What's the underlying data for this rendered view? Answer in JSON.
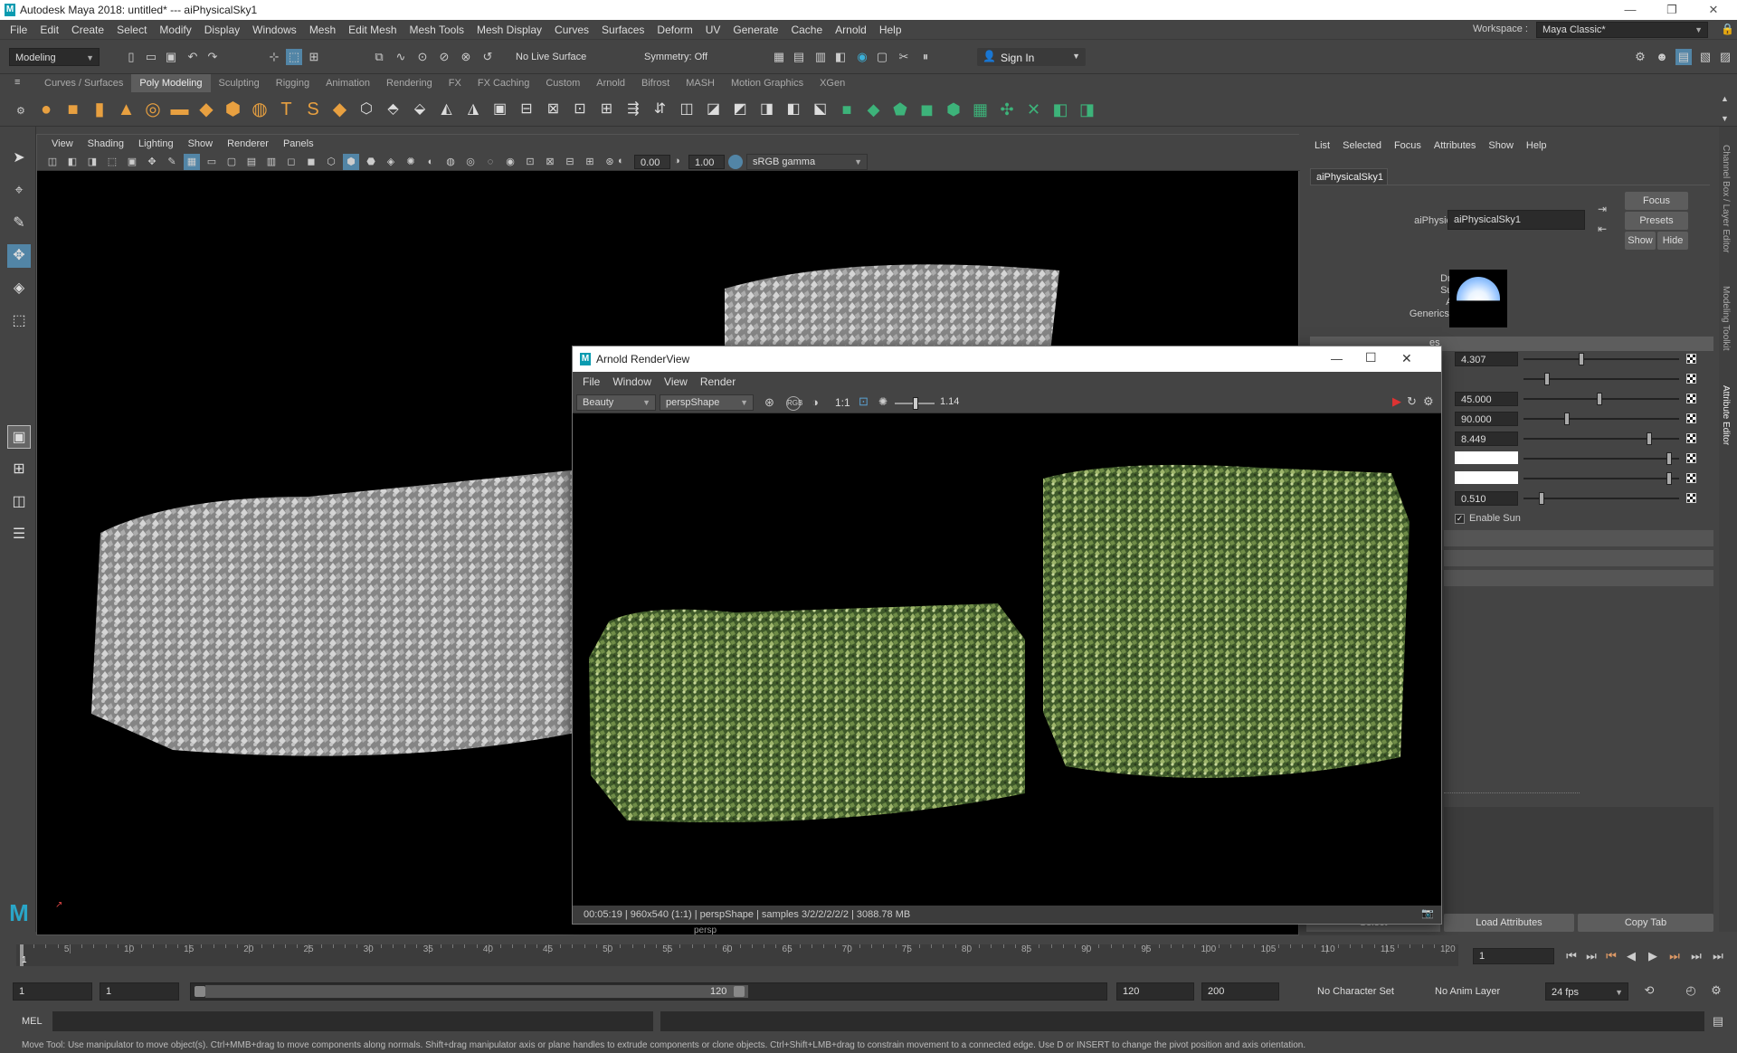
{
  "window": {
    "title": "Autodesk Maya 2018: untitled*   ---   aiPhysicalSky1"
  },
  "menubar": [
    "File",
    "Edit",
    "Create",
    "Select",
    "Modify",
    "Display",
    "Windows",
    "Mesh",
    "Edit Mesh",
    "Mesh Tools",
    "Mesh Display",
    "Curves",
    "Surfaces",
    "Deform",
    "UV",
    "Generate",
    "Cache",
    "Arnold",
    "Help"
  ],
  "status_line": {
    "menuset": "Modeling",
    "live_surface": "No Live Surface",
    "symmetry": "Symmetry: Off",
    "sign_in": "Sign In",
    "workspace_label": "Workspace :",
    "workspace_value": "Maya Classic*"
  },
  "shelf_tabs": [
    "Curves / Surfaces",
    "Poly Modeling",
    "Sculpting",
    "Rigging",
    "Animation",
    "Rendering",
    "FX",
    "FX Caching",
    "Custom",
    "Arnold",
    "Bifrost",
    "MASH",
    "Motion Graphics",
    "XGen"
  ],
  "shelf_active": "Poly Modeling",
  "viewport": {
    "menus": [
      "View",
      "Shading",
      "Lighting",
      "Show",
      "Renderer",
      "Panels"
    ],
    "exposure": "0.00",
    "gamma": "1.00",
    "color_space": "sRGB gamma",
    "camera_label": "persp"
  },
  "renderview": {
    "title": "Arnold RenderView",
    "menus": [
      "File",
      "Window",
      "View",
      "Render"
    ],
    "aov": "Beauty",
    "camera": "perspShape",
    "zoom": "1:1",
    "exposure": "1.14",
    "status": "00:05:19 | 960x540 (1:1) | perspShape  | samples 3/2/2/2/2/2 | 3088.78 MB"
  },
  "attribute_editor": {
    "menus": [
      "List",
      "Selected",
      "Focus",
      "Attributes",
      "Show",
      "Help"
    ],
    "tab": "aiPhysicalSky1",
    "node_label": "aiPhysicalSky:",
    "node_name": "aiPhysicalSky1",
    "buttons": {
      "focus": "Focus",
      "presets": "Presets",
      "show": "Show",
      "hide": "Hide"
    },
    "swatch_labels": [
      "Drawdb",
      "Surface",
      "Arnold",
      "Genericshader"
    ],
    "section_partial": "es",
    "values": [
      "4.307",
      "",
      "45.000",
      "90.000",
      "8.449",
      "",
      "",
      "0.510"
    ],
    "slider_levels": [
      0.37,
      0.14,
      0.49,
      0.27,
      0.82,
      0.95,
      0.95,
      0.1
    ],
    "enable_sun": "Enable Sun",
    "load_attributes": "Load Attributes",
    "copy_tab": "Copy Tab",
    "select_partial": "Select"
  },
  "side_tabs": [
    "Channel Box / Layer Editor",
    "Modeling Toolkit",
    "Attribute Editor"
  ],
  "timeline": {
    "ticks": [
      "5",
      "10",
      "15",
      "20",
      "25",
      "30",
      "35",
      "40",
      "45",
      "50",
      "55",
      "60",
      "65",
      "70",
      "75",
      "80",
      "85",
      "90",
      "95",
      "100",
      "105",
      "110",
      "115",
      "120"
    ],
    "current_frame": "1",
    "frame_field": "1",
    "start": "1",
    "start2": "1",
    "range_start": "1",
    "range_end": "120",
    "end": "120",
    "end2": "200",
    "character_set": "No Character Set",
    "anim_layer": "No Anim Layer",
    "fps": "24 fps"
  },
  "command_line": {
    "label": "MEL"
  },
  "help_line": "Move Tool: Use manipulator to move object(s). Ctrl+MMB+drag to move components along normals. Shift+drag manipulator axis or plane handles to extrude components or clone objects. Ctrl+Shift+LMB+drag to constrain movement to a connected edge. Use D or INSERT to change the pivot position and axis orientation.",
  "colors": {
    "accent": "#5285a6",
    "shelf_orange": "#e8a040",
    "shelf_green": "#3db37a"
  }
}
